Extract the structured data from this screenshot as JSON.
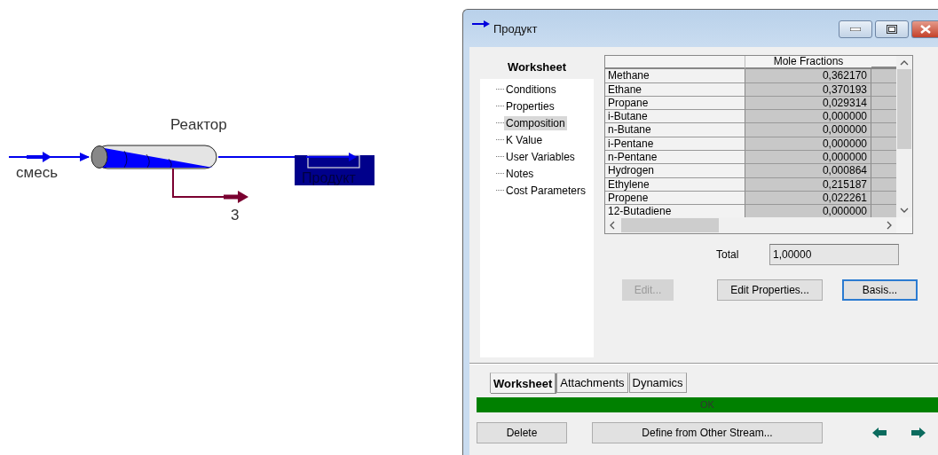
{
  "flowsheet": {
    "unit": {
      "label": "Реактор"
    },
    "streams": [
      {
        "kind": "feed",
        "label": "смесь"
      },
      {
        "kind": "bottom",
        "label": "3"
      },
      {
        "kind": "product",
        "label": "Продукт"
      }
    ]
  },
  "window": {
    "title": "Продукт"
  },
  "nav": {
    "title": "Worksheet",
    "items": [
      {
        "label": "Conditions",
        "selected": false
      },
      {
        "label": "Properties",
        "selected": false
      },
      {
        "label": "Composition",
        "selected": true
      },
      {
        "label": "K Value",
        "selected": false
      },
      {
        "label": "User Variables",
        "selected": false
      },
      {
        "label": "Notes",
        "selected": false
      },
      {
        "label": "Cost Parameters",
        "selected": false
      }
    ]
  },
  "table": {
    "columns": [
      "Mole Fractions"
    ],
    "rows": [
      {
        "name": "Methane",
        "value": "0,362170"
      },
      {
        "name": "Ethane",
        "value": "0,370193"
      },
      {
        "name": "Propane",
        "value": "0,029314"
      },
      {
        "name": "i-Butane",
        "value": "0,000000"
      },
      {
        "name": "n-Butane",
        "value": "0,000000"
      },
      {
        "name": "i-Pentane",
        "value": "0,000000"
      },
      {
        "name": "n-Pentane",
        "value": "0,000000"
      },
      {
        "name": "Hydrogen",
        "value": "0,000864"
      },
      {
        "name": "Ethylene",
        "value": "0,215187"
      },
      {
        "name": "Propene",
        "value": "0,022261"
      },
      {
        "name": "12-Butadiene",
        "value": "0,000000"
      }
    ]
  },
  "total": {
    "label": "Total",
    "value": "1,00000"
  },
  "actions": [
    {
      "label": "Edit...",
      "disabled": true,
      "default": false
    },
    {
      "label": "Edit Properties...",
      "disabled": false,
      "default": false
    },
    {
      "label": "Basis...",
      "disabled": false,
      "default": true
    }
  ],
  "tabs": [
    {
      "label": "Worksheet",
      "selected": true
    },
    {
      "label": "Attachments",
      "selected": false
    },
    {
      "label": "Dynamics",
      "selected": false
    }
  ],
  "status": {
    "text": "OK"
  },
  "bottom_buttons": [
    {
      "label": "Delete"
    },
    {
      "label": "Define from Other Stream..."
    }
  ]
}
